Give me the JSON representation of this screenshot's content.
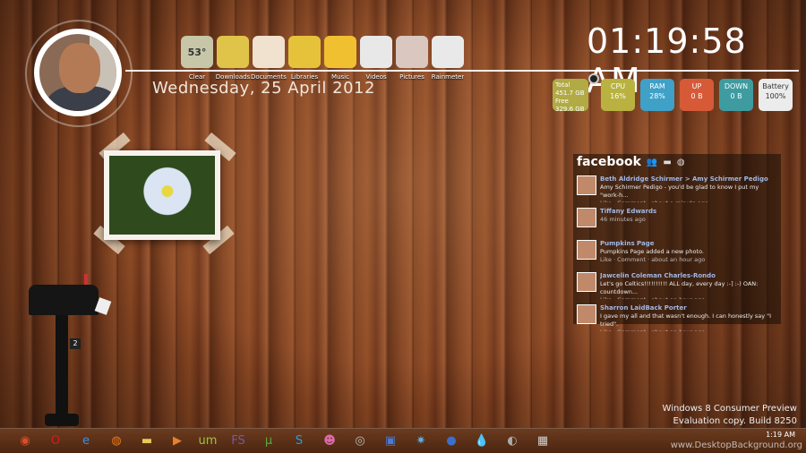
{
  "clock": {
    "time": "01:19:58 AM"
  },
  "date": "Wednesday, 25 April 2012",
  "dock": [
    {
      "label": "",
      "icon": "weather-icon",
      "text": "53°",
      "sub": "Clear",
      "color": "#c7c6a8"
    },
    {
      "label": "Downloads",
      "icon": "downloads-icon",
      "text": "",
      "color": "#e0c44a"
    },
    {
      "label": "Documents",
      "icon": "documents-icon",
      "text": "",
      "color": "#f0e2cf"
    },
    {
      "label": "Libraries",
      "icon": "libraries-icon",
      "text": "",
      "color": "#e6c23a"
    },
    {
      "label": "Music",
      "icon": "music-icon",
      "text": "",
      "color": "#f0c030"
    },
    {
      "label": "Videos",
      "icon": "videos-icon",
      "text": "",
      "color": "#e8e8e8"
    },
    {
      "label": "Pictures",
      "icon": "pictures-icon",
      "text": "",
      "color": "#d9c7c0"
    },
    {
      "label": "Rainmeter",
      "icon": "rainmeter-icon",
      "text": "",
      "color": "#e9e9e9"
    }
  ],
  "stats": {
    "disk": {
      "total_label": "Total",
      "total": "451.7 GB",
      "free_label": "Free",
      "free": "329.6 GB"
    },
    "cpu": {
      "label": "CPU",
      "value": "16%"
    },
    "ram": {
      "label": "RAM",
      "value": "28%"
    },
    "up": {
      "label": "UP",
      "value": "0 B"
    },
    "down": {
      "label": "DOWN",
      "value": "0 B"
    },
    "battery": {
      "label": "Battery",
      "value": "100%"
    }
  },
  "facebook": {
    "title": "facebook",
    "posts": [
      {
        "name": "Beth Aldridge Schirmer > Amy Schirmer Pedigo",
        "text": "Amy Schirmer Pedigo - you'd be glad to know I put my \"work-h...",
        "meta": "Like · Comment · about a minute ago"
      },
      {
        "name": "Tiffany Edwards",
        "text": "",
        "meta": "46 minutes ago"
      },
      {
        "name": "Pumpkins Page",
        "text": "Pumpkins Page added a new photo.",
        "meta": "Like · Comment · about an hour ago"
      },
      {
        "name": "Jawcelin Coleman Charles-Rondo",
        "text": "Let's go Celtics!!!!!!!!!! ALL day, every day :-] :-) OAN: countdown...",
        "meta": "Like · Comment · about an hour ago"
      },
      {
        "name": "Sharron LaidBack Porter",
        "text": "I gave my all and that wasn't enough. I can honestly say \"I tried\".",
        "meta": "Like · Comment · about an hour ago"
      }
    ]
  },
  "mail": {
    "count": "2"
  },
  "watermark": {
    "line1": "Windows 8 Consumer Preview",
    "line2": "Evaluation copy. Build 8250"
  },
  "taskbar": {
    "icons": [
      {
        "name": "chrome-icon",
        "glyph": "◉",
        "color": "#e24a2a"
      },
      {
        "name": "opera-icon",
        "glyph": "O",
        "color": "#d41c1c"
      },
      {
        "name": "ie-icon",
        "glyph": "e",
        "color": "#3a8ee6"
      },
      {
        "name": "firefox-icon",
        "glyph": "◍",
        "color": "#e8771c"
      },
      {
        "name": "folder-icon",
        "glyph": "▬",
        "color": "#e7c85a"
      },
      {
        "name": "media-player-icon",
        "glyph": "▶",
        "color": "#e8812a"
      },
      {
        "name": "um-icon",
        "glyph": "um",
        "color": "#9bc53d"
      },
      {
        "name": "fs-icon",
        "glyph": "FS",
        "color": "#7a56a6"
      },
      {
        "name": "utorrent-icon",
        "glyph": "µ",
        "color": "#58a83a"
      },
      {
        "name": "skype-icon",
        "glyph": "S",
        "color": "#1ea0e0"
      },
      {
        "name": "messenger-icon",
        "glyph": "☻",
        "color": "#e06ab0"
      },
      {
        "name": "webcam-icon",
        "glyph": "◎",
        "color": "#bbbbbb"
      },
      {
        "name": "picture-tool-icon",
        "glyph": "▣",
        "color": "#4a7ad6"
      },
      {
        "name": "network-icon",
        "glyph": "✷",
        "color": "#5fb0e6"
      },
      {
        "name": "google-earth-icon",
        "glyph": "●",
        "color": "#3b6fd1"
      },
      {
        "name": "droplet-icon",
        "glyph": "💧",
        "color": "#9bc7e6"
      },
      {
        "name": "globe-icon",
        "glyph": "◐",
        "color": "#aaaaaa"
      },
      {
        "name": "calculator-icon",
        "glyph": "▦",
        "color": "#d0d0d0"
      }
    ],
    "time": "1:19 AM",
    "date": "4/25/2012",
    "site": "www.DesktopBackground.org"
  }
}
